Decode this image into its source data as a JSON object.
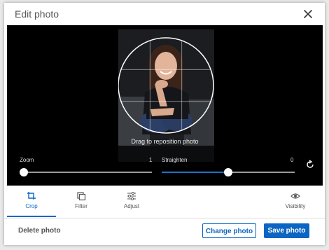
{
  "dialog": {
    "title": "Edit photo",
    "close_icon": "close-icon"
  },
  "editor": {
    "drag_hint": "Drag to reposition photo",
    "zoom": {
      "label": "Zoom",
      "value": "1",
      "level": 0.0
    },
    "straighten": {
      "label": "Straighten",
      "value": "0",
      "level": 0.5
    },
    "reset_icon": "rotate-reset-icon"
  },
  "tabs": [
    {
      "label": "Crop",
      "icon": "crop-icon",
      "active": true
    },
    {
      "label": "Filter",
      "icon": "filter-icon",
      "active": false
    },
    {
      "label": "Adjust",
      "icon": "adjust-icon",
      "active": false
    },
    {
      "label": "Visibility",
      "icon": "eye-icon",
      "active": false
    }
  ],
  "footer": {
    "delete_label": "Delete photo",
    "change_label": "Change photo",
    "save_label": "Save photo"
  },
  "colors": {
    "accent": "#0a66c2",
    "editor_bg": "#000000"
  }
}
